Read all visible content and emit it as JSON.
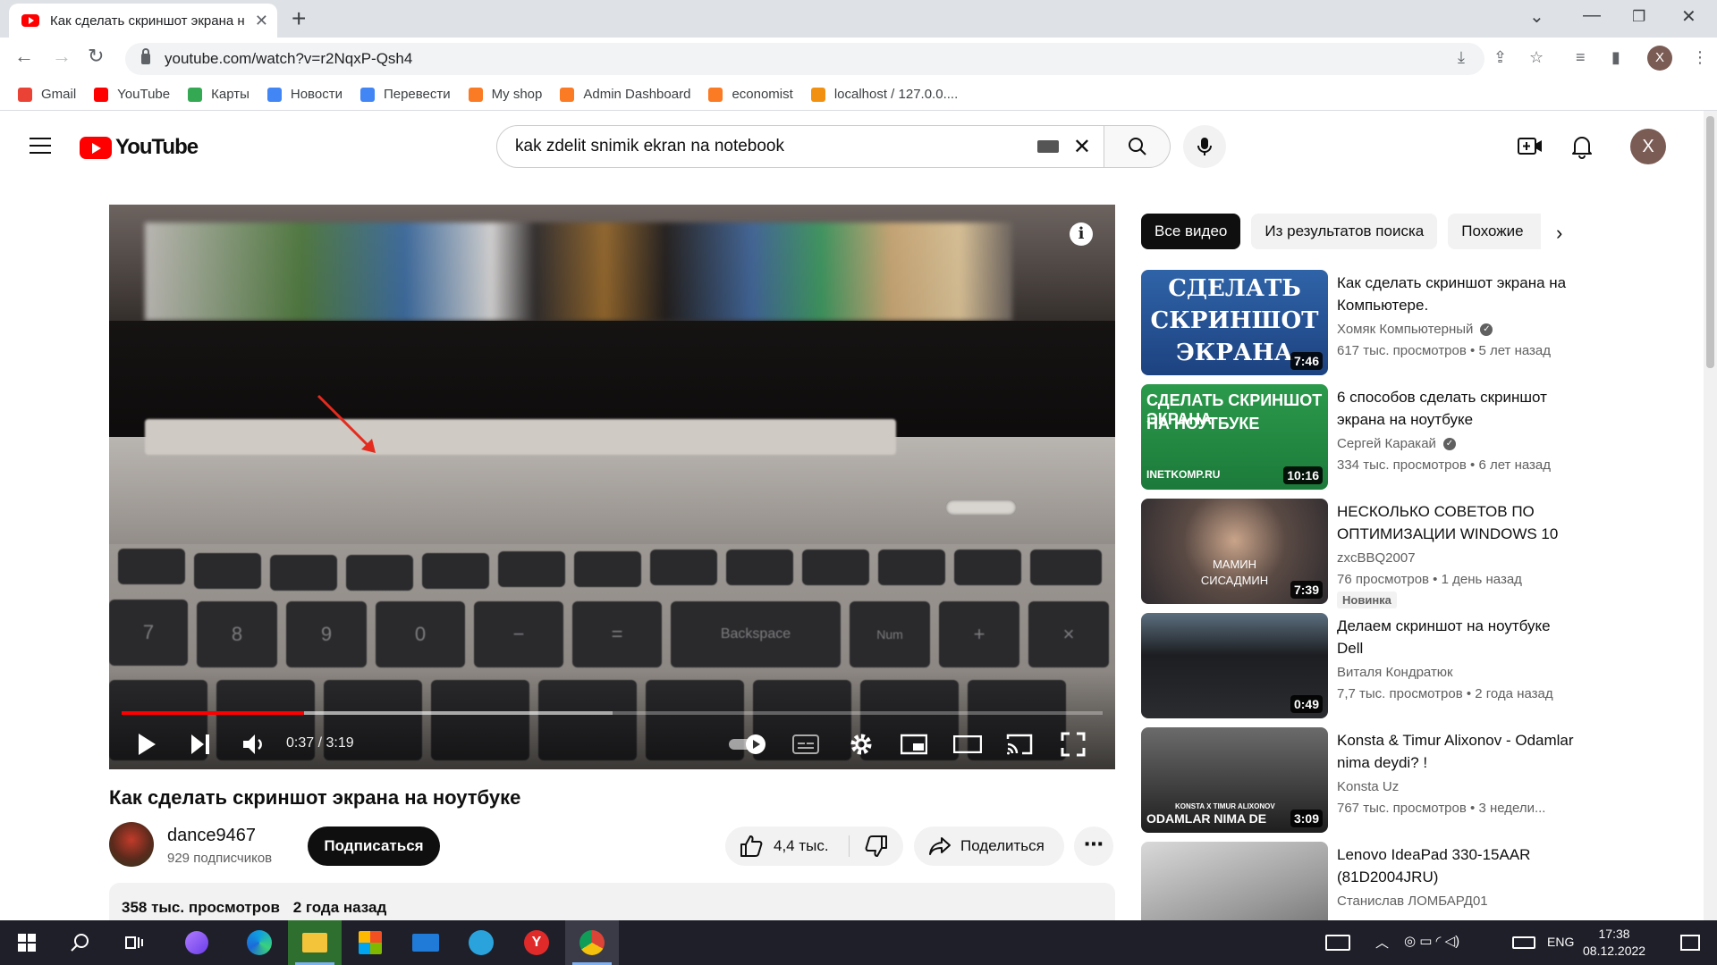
{
  "browser": {
    "tab_title": "Как сделать скриншот экрана н",
    "url": "youtube.com/watch?v=r2NqxP-Qsh4",
    "profile_initial": "X",
    "bookmarks": [
      {
        "label": "Gmail",
        "icon": "gmail-icon",
        "color": "#ea4335"
      },
      {
        "label": "YouTube",
        "icon": "youtube-icon",
        "color": "#ff0000"
      },
      {
        "label": "Карты",
        "icon": "maps-icon",
        "color": "#34a853"
      },
      {
        "label": "Новости",
        "icon": "news-icon",
        "color": "#4285f4"
      },
      {
        "label": "Перевести",
        "icon": "translate-icon",
        "color": "#4285f4"
      },
      {
        "label": "My shop",
        "icon": "xampp-icon",
        "color": "#fb7a24"
      },
      {
        "label": "Admin Dashboard",
        "icon": "xampp-icon",
        "color": "#fb7a24"
      },
      {
        "label": "economist",
        "icon": "xampp-icon",
        "color": "#fb7a24"
      },
      {
        "label": "localhost / 127.0.0....",
        "icon": "phpmyadmin-icon",
        "color": "#f29111"
      }
    ]
  },
  "youtube": {
    "logo_text": "YouTube",
    "search_query": "kak zdelit snimik ekran na notebook",
    "avatar_initial": "X"
  },
  "player": {
    "current_time": "0:37",
    "duration": "3:19",
    "time_display": "0:37 / 3:19",
    "played_fraction": 0.186,
    "buffered_fraction": 0.5
  },
  "video": {
    "title": "Как сделать скриншот экрана на ноутбуке",
    "channel": "dance9467",
    "subscribers": "929 подписчиков",
    "subscribe_label": "Подписаться",
    "likes": "4,4 тыс.",
    "share_label": "Поделиться",
    "views": "358 тыс. просмотров",
    "published": "2 года назад"
  },
  "sidebar": {
    "chips": [
      "Все видео",
      "Из результатов поиска",
      "Похожие"
    ],
    "recommendations": [
      {
        "title": "Как сделать скриншот экрана на Компьютере.",
        "channel": "Хомяк Компьютерный",
        "verified": true,
        "views": "617 тыс. просмотров",
        "age": "5 лет назад",
        "duration": "7:46",
        "thumb_text": [
          "СДЕЛАТЬ",
          "СКРИНШОТ",
          "ЭКРАНА"
        ]
      },
      {
        "title": "6 способов сделать скриншот экрана на ноутбуке",
        "channel": "Сергей Каракай",
        "verified": true,
        "views": "334 тыс. просмотров",
        "age": "6 лет назад",
        "duration": "10:16",
        "thumb_text": [
          "СДЕЛАТЬ СКРИНШОТ ЭКРАНА",
          "НА НОУТБУКЕ",
          "INETKOMP.RU"
        ]
      },
      {
        "title": "НЕСКОЛЬКО СОВЕТОВ ПО ОПТИМИЗАЦИИ WINDOWS 10",
        "channel": "zxcBBQ2007",
        "verified": false,
        "views": "76 просмотров",
        "age": "1 день назад",
        "duration": "7:39",
        "badge": "Новинка",
        "thumb_text": [
          "МАМИН",
          "СИСАДМИН"
        ]
      },
      {
        "title": "Делаем скриншот на ноутбуке Dell",
        "channel": "Виталя Кондратюк",
        "verified": false,
        "views": "7,7 тыс. просмотров",
        "age": "2 года назад",
        "duration": "0:49"
      },
      {
        "title": "Konsta & Timur Alixonov - Odamlar nima deydi? !",
        "channel": "Konsta Uz",
        "verified": false,
        "views": "767 тыс. просмотров",
        "age": "3 недели...",
        "duration": "3:09",
        "thumb_text": [
          "KONSTA X TIMUR ALIXONOV",
          "ODAMLAR NIMA DE"
        ]
      },
      {
        "title": "Lenovo IdeaPad 330-15AAR (81D2004JRU)",
        "channel": "Станислав ЛОМБАРД01",
        "verified": false
      }
    ]
  },
  "taskbar": {
    "language": "ENG",
    "time": "17:38",
    "date": "08.12.2022"
  }
}
